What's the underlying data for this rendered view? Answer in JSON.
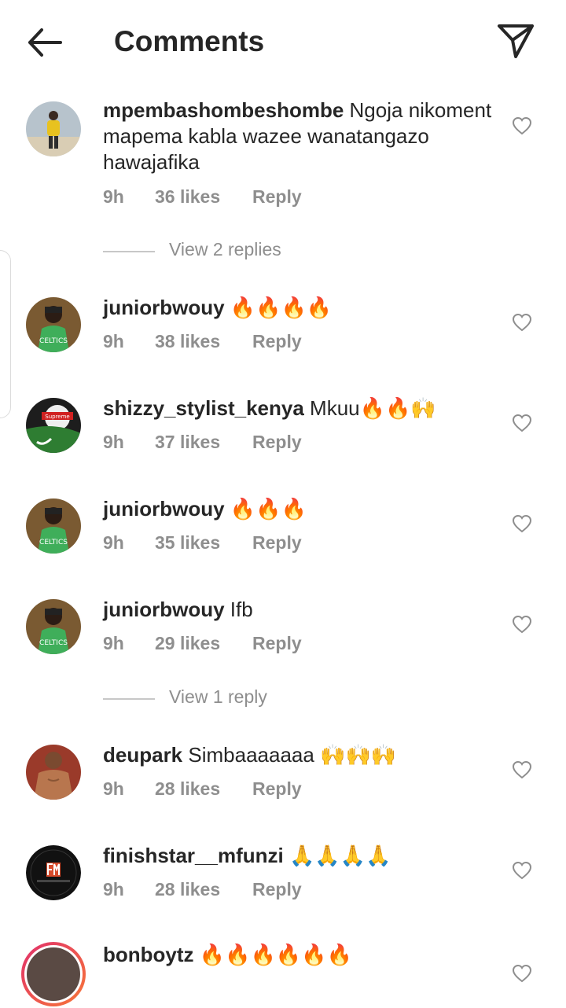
{
  "header": {
    "title": "Comments"
  },
  "comments": [
    {
      "username": "mpembashombeshombe",
      "text": "Ngoja nikoment mapema kabla wazee wanatangazo hawajafika",
      "time": "9h",
      "likes": "36 likes",
      "reply": "Reply",
      "avatar": "beach-person"
    },
    {
      "username": "juniorbwouy",
      "text": "🔥🔥🔥🔥",
      "time": "9h",
      "likes": "38 likes",
      "reply": "Reply",
      "avatar": "celtics-jersey"
    },
    {
      "username": "shizzy_stylist_kenya",
      "text": "Mkuu🔥🔥🙌",
      "time": "9h",
      "likes": "37 likes",
      "reply": "Reply",
      "avatar": "supreme-cap"
    },
    {
      "username": "juniorbwouy",
      "text": "🔥🔥🔥",
      "time": "9h",
      "likes": "35 likes",
      "reply": "Reply",
      "avatar": "celtics-jersey"
    },
    {
      "username": "juniorbwouy",
      "text": "Ifb",
      "time": "9h",
      "likes": "29 likes",
      "reply": "Reply",
      "avatar": "celtics-jersey"
    },
    {
      "username": "deupark",
      "text": "Simbaaaaaaa 🙌🙌🙌",
      "time": "9h",
      "likes": "28 likes",
      "reply": "Reply",
      "avatar": "shirtless-man"
    },
    {
      "username": "finishstar__mfunzi",
      "text": "🙏🙏🙏🙏",
      "time": "9h",
      "likes": "28 likes",
      "reply": "Reply",
      "avatar": "fm-logo"
    },
    {
      "username": "bonboytz",
      "text": "🔥🔥🔥🔥🔥🔥",
      "avatar": "story-ring"
    }
  ],
  "view_replies": [
    {
      "label": "View 2 replies"
    },
    {
      "label": "View 1 reply"
    }
  ],
  "icons": {
    "back": "back-arrow-icon",
    "send": "send-paper-plane-icon",
    "like": "heart-icon"
  },
  "colors": {
    "text": "#262626",
    "secondary": "#8e8e8e",
    "story_ring_start": "#e1306c",
    "story_ring_end": "#f77737"
  }
}
